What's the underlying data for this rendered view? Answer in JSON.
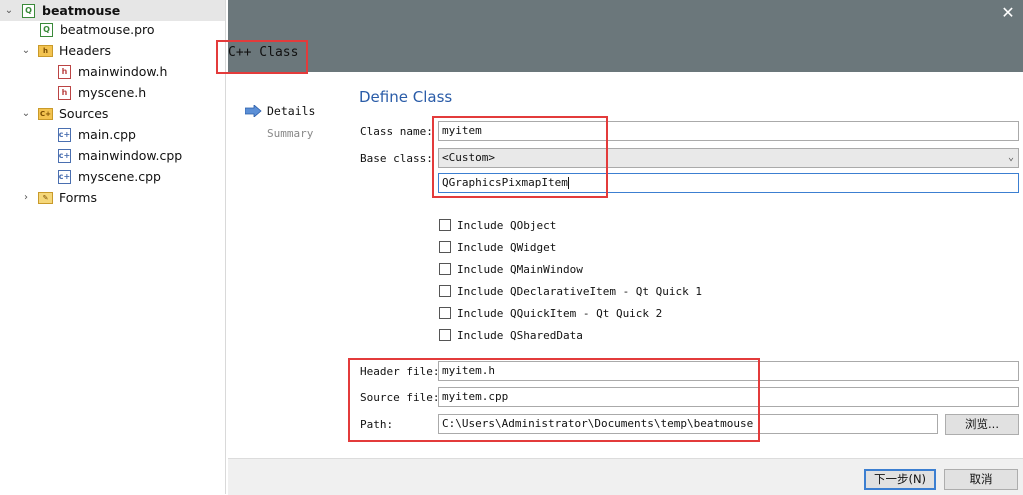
{
  "project_tree": {
    "items": [
      {
        "label": "beatmouse",
        "icon": "project-icon",
        "expanded": true
      },
      {
        "label": "beatmouse.pro",
        "icon": "pro-file-icon"
      },
      {
        "label": "Headers",
        "icon": "headers-folder-icon",
        "expanded": true
      },
      {
        "label": "mainwindow.h",
        "icon": "header-file-icon"
      },
      {
        "label": "myscene.h",
        "icon": "header-file-icon"
      },
      {
        "label": "Sources",
        "icon": "sources-folder-icon",
        "expanded": true
      },
      {
        "label": "main.cpp",
        "icon": "cpp-file-icon"
      },
      {
        "label": "mainwindow.cpp",
        "icon": "cpp-file-icon"
      },
      {
        "label": "myscene.cpp",
        "icon": "cpp-file-icon"
      },
      {
        "label": "Forms",
        "icon": "forms-folder-icon",
        "expanded": false
      }
    ]
  },
  "wizard": {
    "title": "C++ Class",
    "close_icon": "close-icon",
    "steps": [
      {
        "label": "Details",
        "active": true
      },
      {
        "label": "Summary",
        "active": false
      }
    ],
    "page_heading": "Define Class",
    "class_name_label": "Class name:",
    "class_name_value": "myitem",
    "base_class_label": "Base class:",
    "base_class_value": "<Custom>",
    "custom_base_value": "QGraphicsPixmapItem",
    "includes": [
      {
        "label": "Include QObject",
        "checked": false
      },
      {
        "label": "Include QWidget",
        "checked": false
      },
      {
        "label": "Include QMainWindow",
        "checked": false
      },
      {
        "label": "Include QDeclarativeItem - Qt Quick 1",
        "checked": false
      },
      {
        "label": "Include QQuickItem - Qt Quick 2",
        "checked": false
      },
      {
        "label": "Include QSharedData",
        "checked": false
      }
    ],
    "header_file_label": "Header file:",
    "header_file_value": "myitem.h",
    "source_file_label": "Source file:",
    "source_file_value": "myitem.cpp",
    "path_label": "Path:",
    "path_value": "C:\\Users\\Administrator\\Documents\\temp\\beatmouse",
    "browse_label": "浏览...",
    "next_label": "下一步(N)",
    "cancel_label": "取消"
  },
  "colors": {
    "header_bg": "#6b777b",
    "heading_blue": "#2a5ca8",
    "highlight_red": "#e33b3b"
  }
}
